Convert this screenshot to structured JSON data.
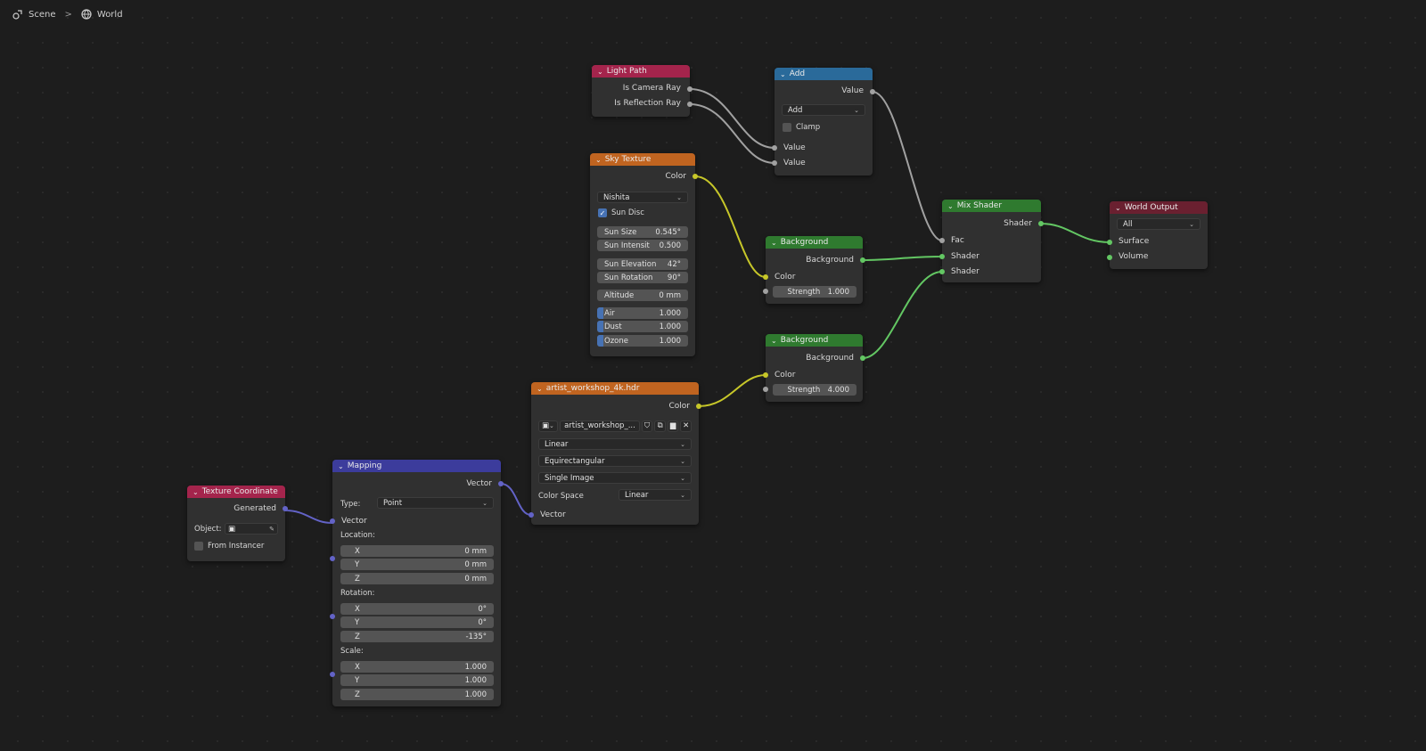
{
  "breadcrumb": {
    "scene": "Scene",
    "world": "World",
    "separator": ">"
  },
  "colors": {
    "shader_header": "#2f7a2f",
    "input_header": "#a4244c",
    "texture_header": "#c06420",
    "converter_header": "#2a6a9a",
    "vector_header": "#3c3c9c",
    "output_header": "#6a2030"
  },
  "light_path": {
    "title": "Light Path",
    "out1": "Is Camera Ray",
    "out2": "Is Reflection Ray"
  },
  "add": {
    "title": "Add",
    "out": "Value",
    "op": "Add",
    "clamp": "Clamp",
    "in1": "Value",
    "in2": "Value"
  },
  "sky": {
    "title": "Sky Texture",
    "out": "Color",
    "type": "Nishita",
    "sun_disc": "Sun Disc",
    "sun_size_l": "Sun Size",
    "sun_size_v": "0.545°",
    "sun_int_l": "Sun Intensit",
    "sun_int_v": "0.500",
    "sun_elev_l": "Sun Elevation",
    "sun_elev_v": "42°",
    "sun_rot_l": "Sun Rotation",
    "sun_rot_v": "90°",
    "alt_l": "Altitude",
    "alt_v": "0 mm",
    "air_l": "Air",
    "air_v": "1.000",
    "dust_l": "Dust",
    "dust_v": "1.000",
    "ozone_l": "Ozone",
    "ozone_v": "1.000"
  },
  "bg1": {
    "title": "Background",
    "out": "Background",
    "in_color": "Color",
    "strength_l": "Strength",
    "strength_v": "1.000"
  },
  "bg2": {
    "title": "Background",
    "out": "Background",
    "in_color": "Color",
    "strength_l": "Strength",
    "strength_v": "4.000"
  },
  "mix": {
    "title": "Mix Shader",
    "out": "Shader",
    "fac": "Fac",
    "in1": "Shader",
    "in2": "Shader"
  },
  "world_out": {
    "title": "World Output",
    "target": "All",
    "surface": "Surface",
    "volume": "Volume"
  },
  "env": {
    "title": "artist_workshop_4k.hdr",
    "out": "Color",
    "image_name": "artist_workshop_...",
    "interp": "Linear",
    "proj": "Equirectangular",
    "source": "Single Image",
    "cs_l": "Color Space",
    "cs_v": "Linear",
    "in_vec": "Vector"
  },
  "mapping": {
    "title": "Mapping",
    "out": "Vector",
    "type_l": "Type:",
    "type_v": "Point",
    "in_vec": "Vector",
    "loc_l": "Location:",
    "rot_l": "Rotation:",
    "scale_l": "Scale:",
    "x": "X",
    "y": "Y",
    "z": "Z",
    "loc_x": "0 mm",
    "loc_y": "0 mm",
    "loc_z": "0 mm",
    "rot_x": "0°",
    "rot_y": "0°",
    "rot_z": "-135°",
    "sc_x": "1.000",
    "sc_y": "1.000",
    "sc_z": "1.000"
  },
  "texcoord": {
    "title": "Texture Coordinate",
    "out": "Generated",
    "object_l": "Object:",
    "from_inst": "From Instancer"
  }
}
